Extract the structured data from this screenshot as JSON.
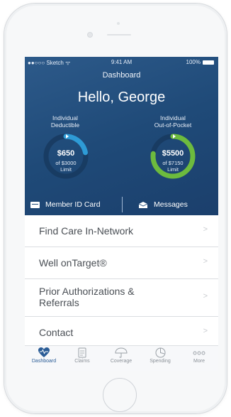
{
  "status_bar": {
    "carrier": "●●○○○ Sketch ᯤ",
    "time": "9:41 AM",
    "battery": "100%"
  },
  "header": {
    "title": "Dashboard",
    "greeting": "Hello, George"
  },
  "gauges": [
    {
      "label_line1": "Individual",
      "label_line2": "Deductible",
      "amount": "$650",
      "limit_line1": "of $3000",
      "limit_line2": "Limit",
      "progress": 0.22,
      "color": "#2e9bd6"
    },
    {
      "label_line1": "Individual",
      "label_line2": "Out-of-Pocket",
      "amount": "$5500",
      "limit_line1": "of $7150",
      "limit_line2": "Limit",
      "progress": 0.77,
      "color": "#6dbb3e"
    }
  ],
  "actions": {
    "member_id": "Member ID Card",
    "messages": "Messages"
  },
  "menu": [
    {
      "label": "Find Care In-Network"
    },
    {
      "label": "Well onTarget®"
    },
    {
      "label_line1": "Prior Authorizations &",
      "label_line2": "Referrals"
    },
    {
      "label": "Contact"
    }
  ],
  "tabs": [
    {
      "label": "Dashboard",
      "icon": "heart-pulse-icon"
    },
    {
      "label": "Claims",
      "icon": "document-icon"
    },
    {
      "label": "Coverage",
      "icon": "umbrella-icon"
    },
    {
      "label": "Spending",
      "icon": "chart-icon"
    },
    {
      "label": "More",
      "icon": "more-dots-icon"
    }
  ],
  "colors": {
    "header_blue": "#1f4a78",
    "tab_active": "#2a5c96",
    "gauge_track": "#17395f"
  }
}
